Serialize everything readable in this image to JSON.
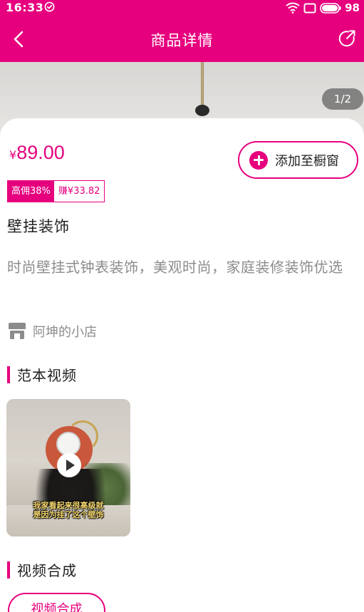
{
  "status_bar": {
    "time": "16:33",
    "battery": "98",
    "icons": [
      "sync-icon",
      "wifi-icon",
      "screen-icon",
      "battery-icon"
    ]
  },
  "nav": {
    "title": "商品详情",
    "back_icon": "chevron-left-icon",
    "share_icon": "share-icon"
  },
  "gallery": {
    "indicator": "1/2"
  },
  "product": {
    "currency": "¥",
    "price": "89.00",
    "add_button_label": "添加至橱窗",
    "commission_tag": "高佣38%",
    "earn_tag": "赚¥33.82",
    "title": "壁挂装饰",
    "description": "时尚壁挂式钟表装饰，美观时尚，家庭装修装饰优选",
    "shop_name": "阿坤的小店"
  },
  "sample_video": {
    "section_title": "范本视频",
    "caption_line1": "我家看起来很高级就",
    "caption_line2": "是因为挂了这个壁饰"
  },
  "video_compose": {
    "section_title": "视频合成",
    "button_label": "视频合成"
  },
  "colors": {
    "brand": "#e6007e",
    "text_primary": "#1e1e1e",
    "text_secondary": "#8c8c8c"
  }
}
